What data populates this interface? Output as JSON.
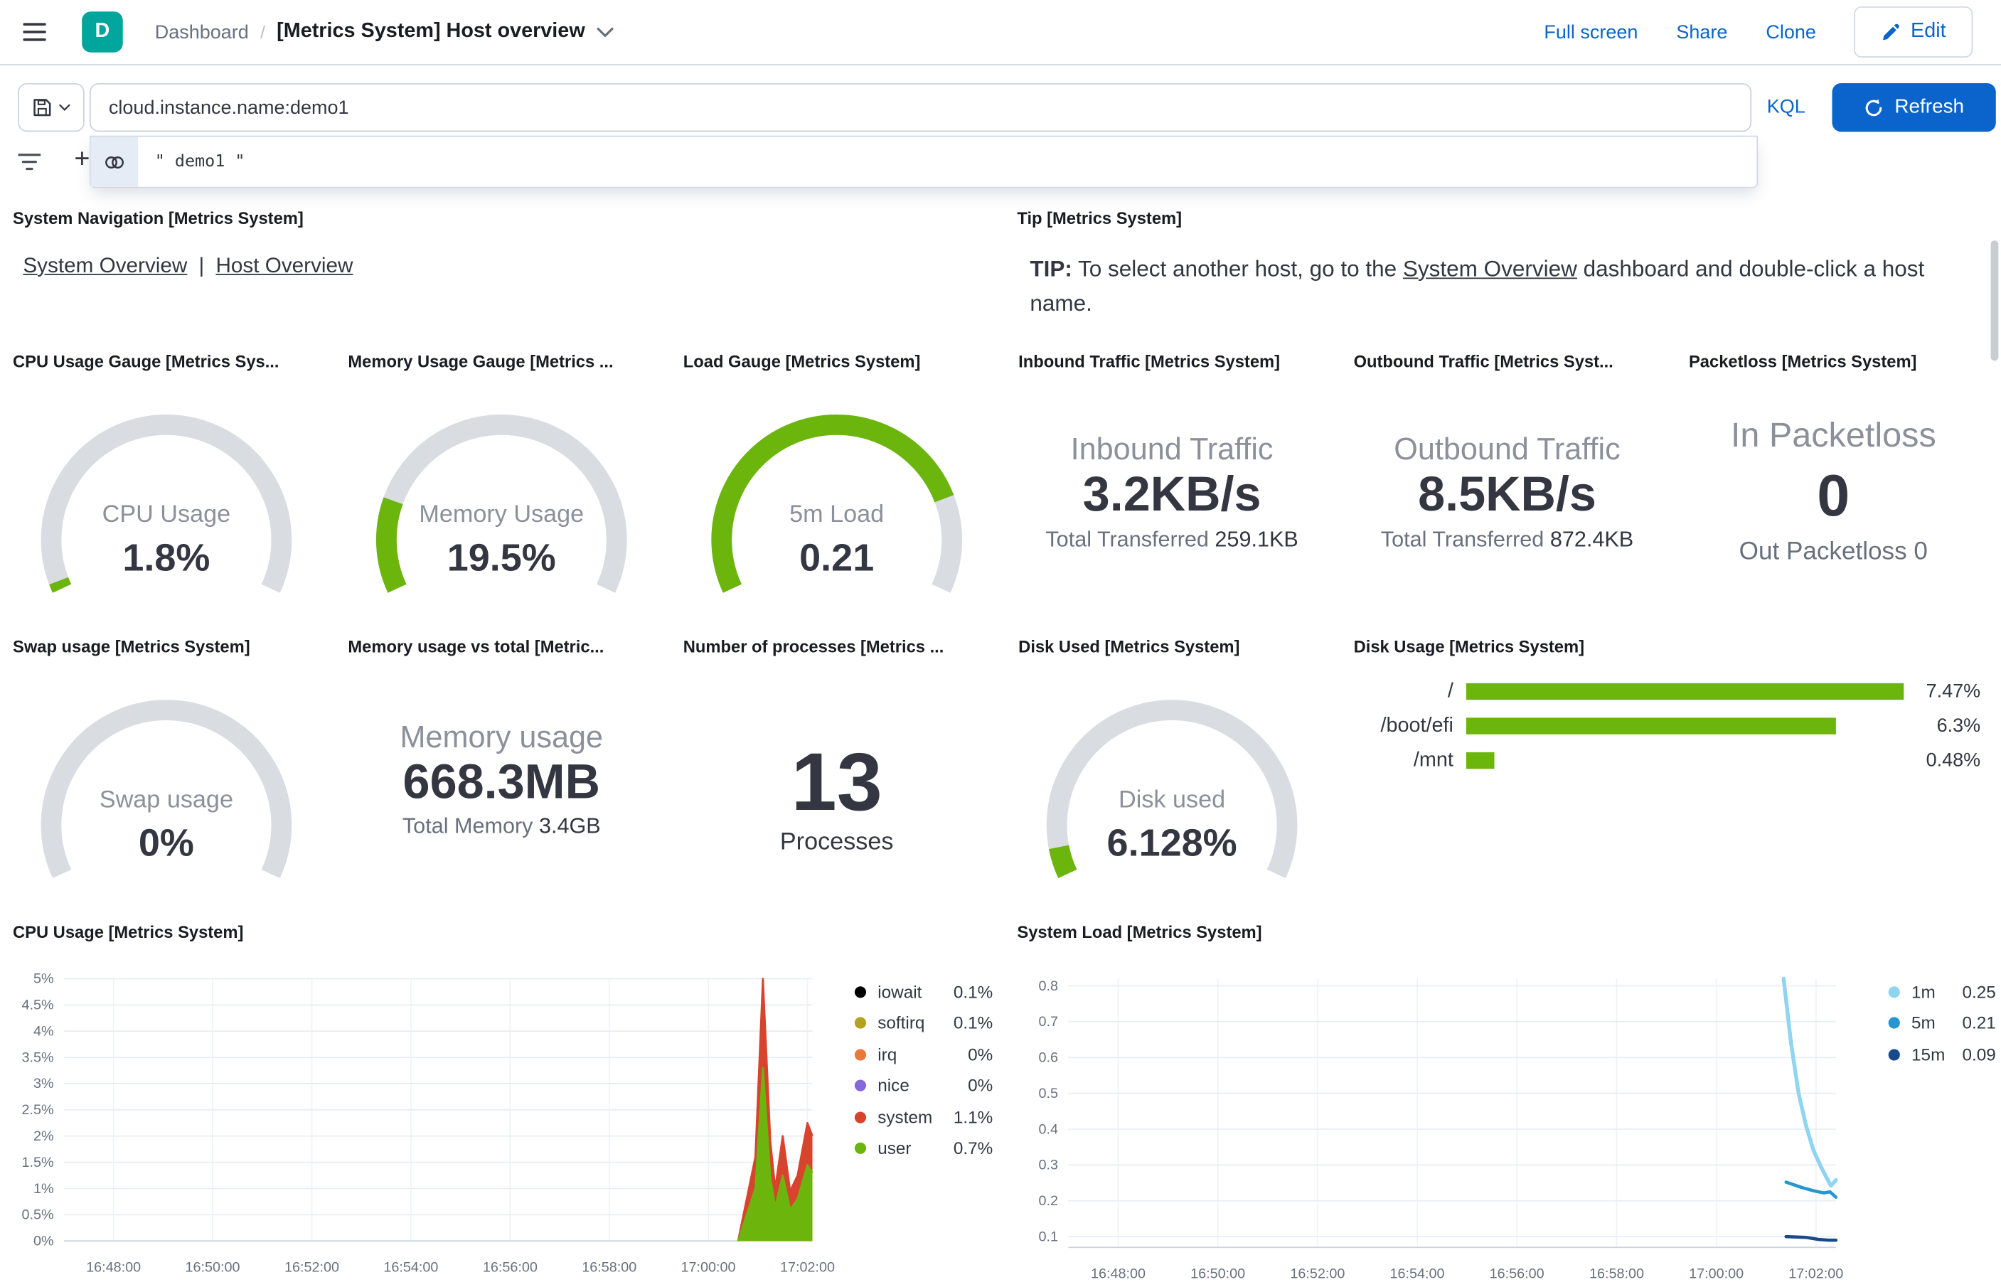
{
  "colors": {
    "accent": "#0b64cc",
    "green": "#6cb50d",
    "red": "#d8432e",
    "track": "#d9dce1",
    "space_teal": "#00a69b"
  },
  "header": {
    "space_initial": "D",
    "breadcrumb": "Dashboard",
    "breadcrumb_separator": "/",
    "title": "[Metrics System] Host overview",
    "full_screen": "Full screen",
    "share": "Share",
    "clone": "Clone",
    "edit": "Edit"
  },
  "query_bar": {
    "query": "cloud.instance.name:demo1",
    "language_label": "KQL",
    "refresh_label": "Refresh",
    "suggestion_text": "\" demo1 \"",
    "add_filter_label": "+"
  },
  "nav_panel": {
    "title": "System Navigation [Metrics System]",
    "link1": "System Overview",
    "divider": "|",
    "link2": "Host Overview"
  },
  "tip_panel": {
    "title": "Tip [Metrics System]",
    "tip_bold": "TIP:",
    "before_link": " To select another host, go to the ",
    "link": "System Overview",
    "after_link": " dashboard and double-click a host name."
  },
  "gauges": {
    "cpu": {
      "title": "CPU Usage Gauge [Metrics Sys...",
      "label": "CPU Usage",
      "value": "1.8%",
      "fraction": 0.018
    },
    "memory": {
      "title": "Memory Usage Gauge [Metrics ...",
      "label": "Memory Usage",
      "value": "19.5%",
      "fraction": 0.195
    },
    "load": {
      "title": "Load Gauge [Metrics System]",
      "label": "5m Load",
      "value": "0.21",
      "fraction": 0.8
    },
    "swap": {
      "title": "Swap usage [Metrics System]",
      "label": "Swap usage",
      "value": "0%",
      "fraction": 0
    },
    "disk": {
      "title": "Disk Used [Metrics System]",
      "label": "Disk used",
      "value": "6.128%",
      "fraction": 0.061
    }
  },
  "metrics": {
    "inbound": {
      "title": "Inbound Traffic [Metrics System]",
      "label": "Inbound Traffic",
      "value": "3.2KB/s",
      "sub_label": "Total Transferred",
      "sub_value": "259.1KB"
    },
    "outbound": {
      "title": "Outbound Traffic [Metrics Syst...",
      "label": "Outbound Traffic",
      "value": "8.5KB/s",
      "sub_label": "Total Transferred",
      "sub_value": "872.4KB"
    },
    "packetloss": {
      "title": "Packetloss [Metrics System]",
      "label": "In Packetloss",
      "value": "0",
      "sub_label": "Out Packetloss",
      "sub_value": "0"
    },
    "memory_total": {
      "title": "Memory usage vs total [Metric...",
      "label": "Memory usage",
      "value": "668.3MB",
      "sub_label": "Total Memory",
      "sub_value": "3.4GB"
    },
    "processes": {
      "title": "Number of processes [Metrics ...",
      "label": "Processes",
      "value": "13"
    }
  },
  "disk_usage": {
    "title": "Disk Usage [Metrics System]",
    "scale_max": 7.53,
    "rows": [
      {
        "label": "/",
        "value": 7.47,
        "text": "7.47%"
      },
      {
        "label": "/boot/efi",
        "value": 6.3,
        "text": "6.3%"
      },
      {
        "label": "/mnt",
        "value": 0.48,
        "text": "0.48%"
      }
    ]
  },
  "chart_data": [
    {
      "type": "area",
      "title": "CPU Usage [Metrics System]",
      "x_domain": [
        0,
        15.1
      ],
      "y_domain": [
        0,
        5
      ],
      "x_ticks": [
        {
          "pos": 1,
          "label": "16:48:00"
        },
        {
          "pos": 3,
          "label": "16:50:00"
        },
        {
          "pos": 5,
          "label": "16:52:00"
        },
        {
          "pos": 7,
          "label": "16:54:00"
        },
        {
          "pos": 9,
          "label": "16:56:00"
        },
        {
          "pos": 11,
          "label": "16:58:00"
        },
        {
          "pos": 13,
          "label": "17:00:00"
        },
        {
          "pos": 15,
          "label": "17:02:00"
        }
      ],
      "y_ticks": [
        {
          "pos": 0,
          "label": "0%"
        },
        {
          "pos": 0.5,
          "label": "0.5%"
        },
        {
          "pos": 1,
          "label": "1%"
        },
        {
          "pos": 1.5,
          "label": "1.5%"
        },
        {
          "pos": 2,
          "label": "2%"
        },
        {
          "pos": 2.5,
          "label": "2.5%"
        },
        {
          "pos": 3,
          "label": "3%"
        },
        {
          "pos": 3.5,
          "label": "3.5%"
        },
        {
          "pos": 4,
          "label": "4%"
        },
        {
          "pos": 4.5,
          "label": "4.5%"
        },
        {
          "pos": 5,
          "label": "5%"
        }
      ],
      "legend": [
        {
          "name": "iowait",
          "value": "0.1%",
          "color": "#000000"
        },
        {
          "name": "softirq",
          "value": "0.1%",
          "color": "#b2a21c"
        },
        {
          "name": "irq",
          "value": "0%",
          "color": "#e8793a"
        },
        {
          "name": "nice",
          "value": "0%",
          "color": "#8268d8"
        },
        {
          "name": "system",
          "value": "1.1%",
          "color": "#d8432e"
        },
        {
          "name": "user",
          "value": "0.7%",
          "color": "#6cb50d"
        }
      ],
      "stacked_x": [
        13.6,
        13.95,
        14.1,
        14.25,
        14.35,
        14.5,
        14.65,
        14.8,
        15.0,
        15.1
      ],
      "series": [
        {
          "name": "system (stacked total)",
          "color": "#d8432e",
          "values": [
            0,
            1.6,
            5.0,
            1.9,
            1.0,
            2.0,
            0.95,
            1.25,
            2.25,
            2.0
          ]
        },
        {
          "name": "user",
          "color": "#6cb50d",
          "values": [
            0,
            1.0,
            3.3,
            1.2,
            0.65,
            1.25,
            0.6,
            0.8,
            1.45,
            1.3
          ]
        }
      ]
    },
    {
      "type": "line",
      "title": "System Load [Metrics System]",
      "x_domain": [
        0,
        15.4
      ],
      "y_domain": [
        0.07,
        0.82
      ],
      "x_ticks": [
        {
          "pos": 1,
          "label": "16:48:00"
        },
        {
          "pos": 3,
          "label": "16:50:00"
        },
        {
          "pos": 5,
          "label": "16:52:00"
        },
        {
          "pos": 7,
          "label": "16:54:00"
        },
        {
          "pos": 9,
          "label": "16:56:00"
        },
        {
          "pos": 11,
          "label": "16:58:00"
        },
        {
          "pos": 13,
          "label": "17:00:00"
        },
        {
          "pos": 15,
          "label": "17:02:00"
        }
      ],
      "y_ticks": [
        {
          "pos": 0.1,
          "label": "0.1"
        },
        {
          "pos": 0.2,
          "label": "0.2"
        },
        {
          "pos": 0.3,
          "label": "0.3"
        },
        {
          "pos": 0.4,
          "label": "0.4"
        },
        {
          "pos": 0.5,
          "label": "0.5"
        },
        {
          "pos": 0.6,
          "label": "0.6"
        },
        {
          "pos": 0.7,
          "label": "0.7"
        },
        {
          "pos": 0.8,
          "label": "0.8"
        }
      ],
      "legend": [
        {
          "name": "1m",
          "value": "0.25",
          "color": "#8fd4f0"
        },
        {
          "name": "5m",
          "value": "0.21",
          "color": "#2596d1"
        },
        {
          "name": "15m",
          "value": "0.09",
          "color": "#17498c"
        }
      ],
      "series": [
        {
          "name": "1m",
          "color": "#8fd4f0",
          "width": 3,
          "points": [
            [
              14.35,
              0.82
            ],
            [
              14.5,
              0.64
            ],
            [
              14.65,
              0.5
            ],
            [
              14.8,
              0.41
            ],
            [
              14.95,
              0.34
            ],
            [
              15.1,
              0.295
            ],
            [
              15.22,
              0.262
            ],
            [
              15.3,
              0.242
            ],
            [
              15.4,
              0.258
            ]
          ]
        },
        {
          "name": "5m",
          "color": "#2596d1",
          "width": 2.5,
          "points": [
            [
              14.4,
              0.252
            ],
            [
              14.7,
              0.238
            ],
            [
              14.95,
              0.228
            ],
            [
              15.15,
              0.222
            ],
            [
              15.28,
              0.225
            ],
            [
              15.4,
              0.21
            ]
          ]
        },
        {
          "name": "15m",
          "color": "#17498c",
          "width": 2.5,
          "points": [
            [
              14.4,
              0.1
            ],
            [
              14.8,
              0.098
            ],
            [
              15.05,
              0.092
            ],
            [
              15.25,
              0.09
            ],
            [
              15.4,
              0.09
            ]
          ]
        }
      ]
    }
  ]
}
